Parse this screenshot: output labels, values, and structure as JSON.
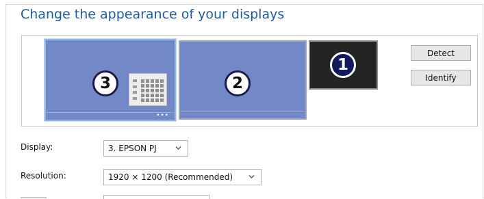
{
  "heading": "Change the appearance of your displays",
  "monitors": [
    {
      "number": "3",
      "selected": true
    },
    {
      "number": "2",
      "selected": false
    },
    {
      "number": "1",
      "selected": false
    }
  ],
  "buttons": {
    "detect": "Detect",
    "identify": "Identify"
  },
  "fields": {
    "display_label": "Display:",
    "display_value": "3. EPSON PJ",
    "resolution_label": "Resolution:",
    "resolution_value": "1920 × 1200 (Recommended)"
  },
  "icons": {
    "monitor_3_overlay": "keypad-icon",
    "monitor_3_more": "more-dots-icon",
    "dropdown": "chevron-down-icon"
  },
  "colors": {
    "heading": "#1e5aa0",
    "monitor_fill": "#7388c7",
    "monitor_1_fill": "#242424",
    "selection_border": "#8fb7e6"
  }
}
